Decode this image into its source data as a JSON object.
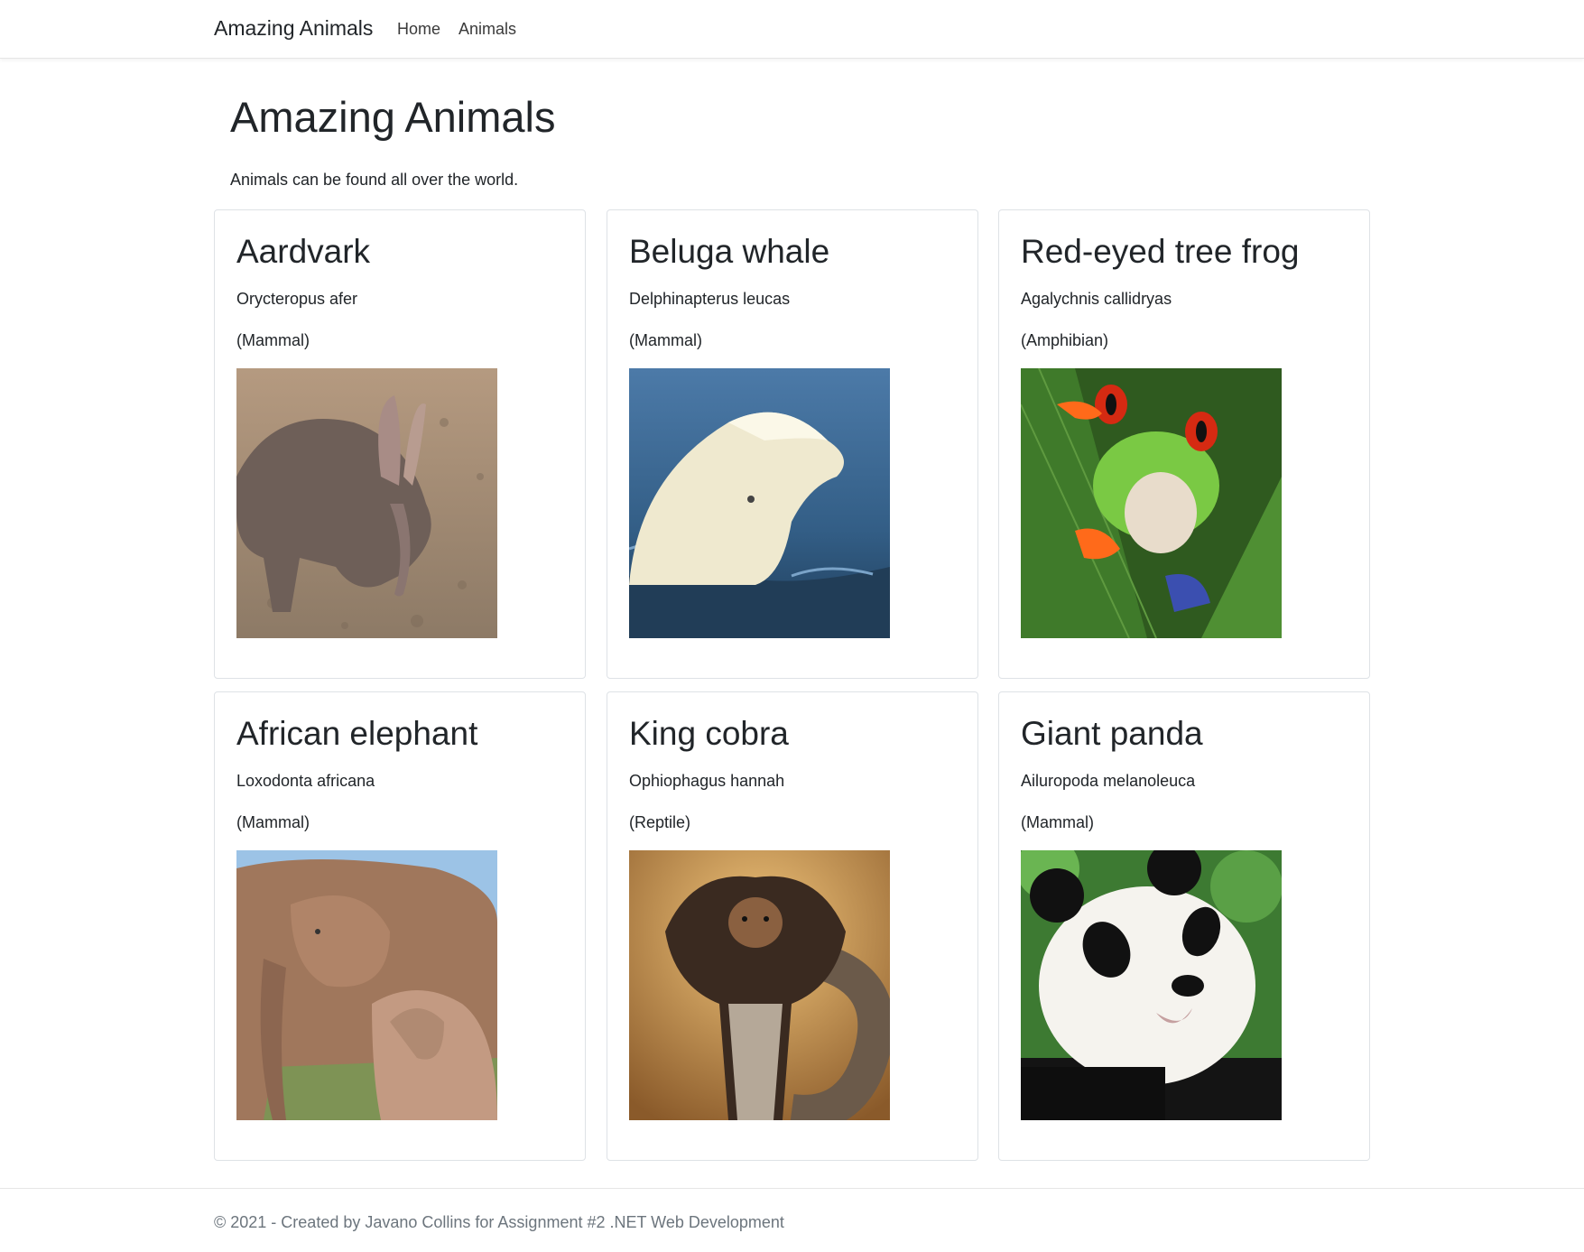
{
  "navbar": {
    "brand": "Amazing Animals",
    "links": [
      "Home",
      "Animals"
    ]
  },
  "main": {
    "title": "Amazing Animals",
    "intro": "Animals can be found all over the world."
  },
  "animals": [
    {
      "name": "Aardvark",
      "scientific_name": "Orycteropus afer",
      "class": "(Mammal)",
      "image": "aardvark-photo"
    },
    {
      "name": "Beluga whale",
      "scientific_name": "Delphinapterus leucas",
      "class": "(Mammal)",
      "image": "beluga-whale-photo"
    },
    {
      "name": "Red-eyed tree frog",
      "scientific_name": "Agalychnis callidryas",
      "class": "(Amphibian)",
      "image": "red-eyed-tree-frog-photo"
    },
    {
      "name": "African elephant",
      "scientific_name": "Loxodonta africana",
      "class": "(Mammal)",
      "image": "african-elephant-photo"
    },
    {
      "name": "King cobra",
      "scientific_name": "Ophiophagus hannah",
      "class": "(Reptile)",
      "image": "king-cobra-photo"
    },
    {
      "name": "Giant panda",
      "scientific_name": "Ailuropoda melanoleuca",
      "class": "(Mammal)",
      "image": "giant-panda-photo"
    }
  ],
  "footer": {
    "text": "© 2021 - Created by Javano Collins for Assignment #2 .NET Web Development"
  },
  "colors": {
    "text": "#212529",
    "muted": "#6c757d",
    "border": "#dee2e6"
  }
}
